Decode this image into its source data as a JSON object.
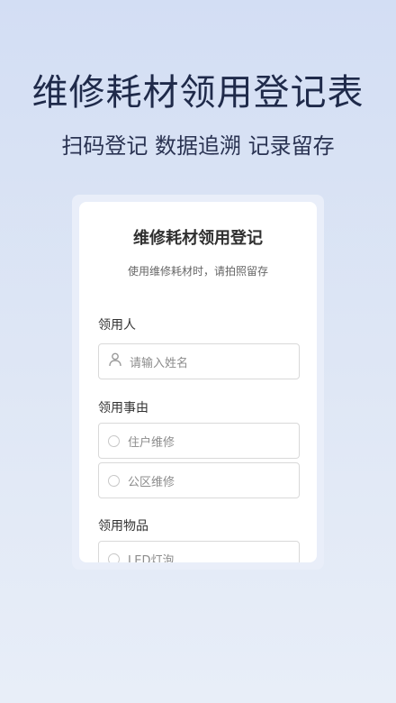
{
  "hero": {
    "title": "维修耗材领用登记表",
    "subtitle": "扫码登记 数据追溯 记录留存"
  },
  "form": {
    "title": "维修耗材领用登记",
    "description": "使用维修耗材时，请拍照留存",
    "recipient": {
      "label": "领用人",
      "placeholder": "请输入姓名",
      "icon": "user-icon"
    },
    "reason": {
      "label": "领用事由",
      "options": [
        "住户维修",
        "公区维修"
      ]
    },
    "items": {
      "label": "领用物品",
      "options": [
        "LED灯泡"
      ]
    }
  }
}
